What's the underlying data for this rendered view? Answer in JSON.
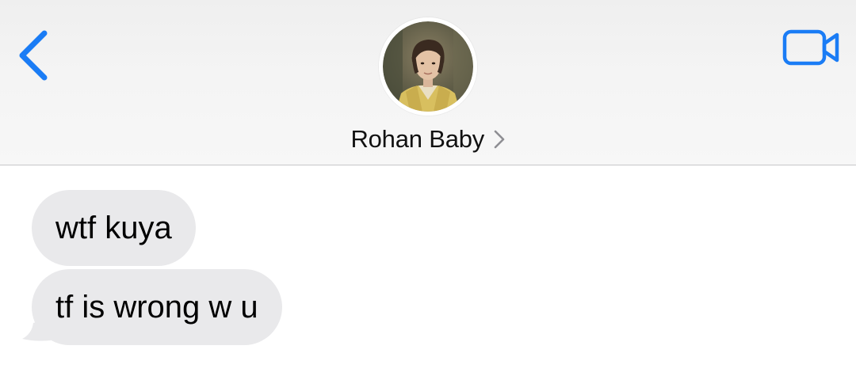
{
  "header": {
    "contact_name": "Rohan Baby",
    "back_icon": "chevron-left-icon",
    "video_icon": "video-camera-icon",
    "disclosure_icon": "chevron-right-icon",
    "accent_color": "#1a7cf5"
  },
  "messages": [
    {
      "direction": "incoming",
      "text": "wtf kuya"
    },
    {
      "direction": "incoming",
      "text": "tf is wrong w u"
    }
  ],
  "colors": {
    "incoming_bubble": "#e9e9eb",
    "header_background": "#f4f4f4"
  }
}
